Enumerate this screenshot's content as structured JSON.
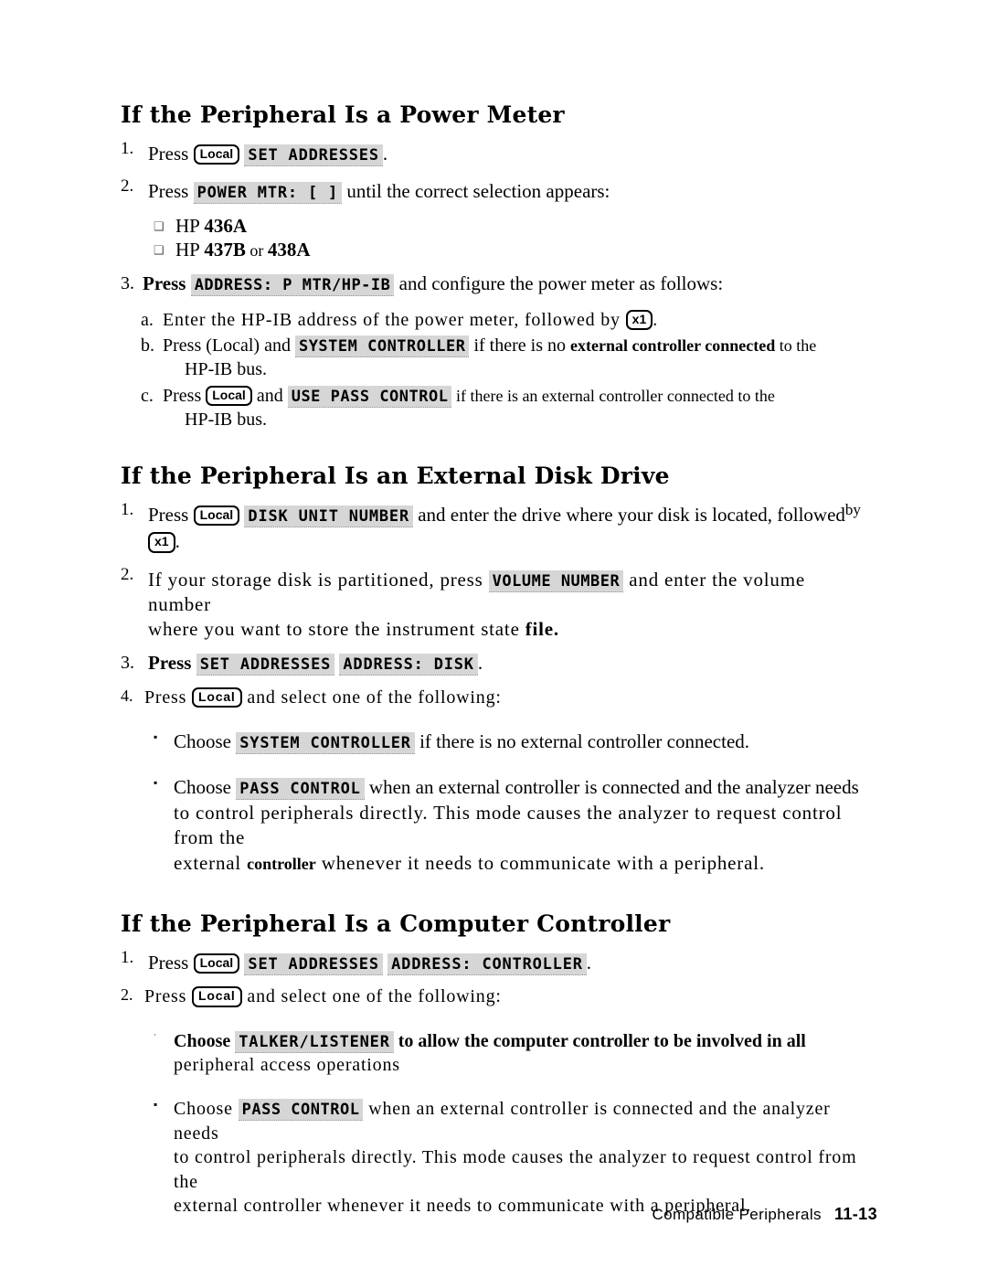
{
  "page": {
    "footer_label": "Compatible Peripherals",
    "page_number": "11-13"
  },
  "keys": {
    "local": "Local",
    "local_plain": "(Local)",
    "x1": "x1"
  },
  "sections": [
    {
      "heading": "If the Peripheral Is a Power Meter",
      "steps": {
        "s1_num": "1.",
        "s1_press": "Press",
        "s1_softkey": "SET ADDRESSES",
        "s1_period": ".",
        "s2_num": "2.",
        "s2_press": "Press",
        "s2_softkey": "POWER MTR: [ ]",
        "s2_tail": "until the correct selection appears:",
        "s3_num": "3.",
        "s3_press": "Press",
        "s3_softkey": "ADDRESS: P MTR/HP-IB",
        "s3_tail": "and configure the power meter as follows:"
      },
      "choices": [
        {
          "marker": "❑",
          "text_pre": "HP ",
          "text_bold": "436A"
        },
        {
          "marker": "❑",
          "text_pre": "HP ",
          "text_bold": "437B",
          "text_mid": " or ",
          "text_bold2": "438A"
        }
      ],
      "sub_steps": [
        {
          "letter": "a.",
          "pre": "Enter the HP-IB address of the power meter, followed by ",
          "key": "x1",
          "post": "."
        },
        {
          "letter": "b.",
          "pre": "Press (Local) and ",
          "softkey": "SYSTEM CONTROLLER",
          "mid": " if there is no ",
          "bold": "external controller connected",
          "post": " to the",
          "cont": "HP-IB bus."
        },
        {
          "letter": "c.",
          "pre": "Press ",
          "key": "Local",
          "mid_pre": " and ",
          "softkey": "USE PASS CONTROL",
          "mid": " if there is an external controller connected to the",
          "cont": "HP-IB bus."
        }
      ]
    },
    {
      "heading": "If the Peripheral Is an External Disk Drive",
      "steps": {
        "s1_num": "1.",
        "s1_press": "Press",
        "s1_key": "Local",
        "s1_softkey": "DISK UNIT NUMBER",
        "s1_tail": "and enter the drive where your disk is located, followed",
        "s1_by": "by",
        "s1_cont_key": "x1",
        "s1_cont_period": ".",
        "s2_num": "2.",
        "s2_pre": "If your storage disk is partitioned, press ",
        "s2_softkey": "VOLUME NUMBER",
        "s2_tail": " and enter the volume number",
        "s2_cont_pre": "where you want to store the instrument state ",
        "s2_cont_bold": "file.",
        "s3_num": "3.",
        "s3_press": "Press",
        "s3_softkey1": "SET ADDRESSES",
        "s3_softkey2": "ADDRESS: DISK",
        "s3_period": ".",
        "s4_num": "4.",
        "s4_press": "Press",
        "s4_key": "Local",
        "s4_tail": " and select one of the following:"
      },
      "bullets": [
        {
          "marker": "▪",
          "pre": "Choose ",
          "softkey": "SYSTEM CONTROLLER",
          "post": " if there is no external controller connected."
        },
        {
          "marker": "▪",
          "pre": "Choose ",
          "softkey": "PASS CONTROL",
          "post": " when an external controller is connected and the analyzer needs",
          "cont1": "to control peripherals directly. This mode causes the analyzer to request control from the",
          "cont2_pre": "external ",
          "cont2_bold": "controller",
          "cont2_post": " whenever it needs to communicate with a peripheral."
        }
      ]
    },
    {
      "heading": "If the Peripheral Is a Computer Controller",
      "steps": {
        "s1_num": "1.",
        "s1_press": "Press",
        "s1_key": "Local",
        "s1_softkey1": "SET ADDRESSES",
        "s1_softkey2": "ADDRESS: CONTROLLER",
        "s1_period": ".",
        "s2_num": "2.",
        "s2_press": "Press",
        "s2_key": "Local",
        "s2_tail": " and select one of the following:"
      },
      "bullets": [
        {
          "marker": "·",
          "pre": "Choose ",
          "softkey": "TALKER/LISTENER",
          "post": " to allow the computer controller to be involved in all",
          "cont1": "peripheral access operations"
        },
        {
          "marker": "▪",
          "pre": "Choose ",
          "softkey": "PASS CONTROL",
          "post": " when an external controller is connected and the analyzer needs",
          "cont1": "to control peripherals directly. This mode causes the analyzer to request control from the",
          "cont2": "external controller whenever it needs to communicate with a peripheral."
        }
      ]
    }
  ]
}
